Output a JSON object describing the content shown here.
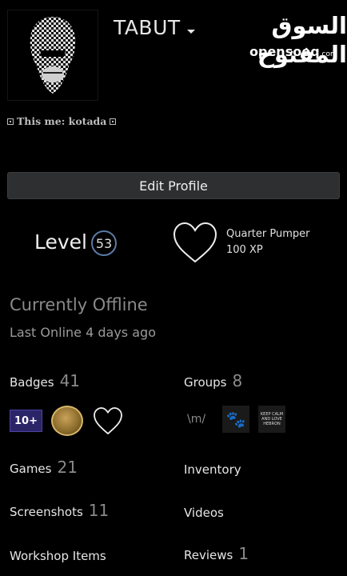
{
  "header": {
    "username": "TABUT",
    "watermark_ar": "السوق المفتوح",
    "watermark_en": "opensooq",
    "watermark_en_tld": ".com"
  },
  "profile": {
    "summary": "This me: kotada",
    "edit_button": "Edit Profile"
  },
  "level": {
    "label": "Level",
    "value": "53",
    "xp_title": "Quarter Pumper",
    "xp_value": "100 XP"
  },
  "status": {
    "state": "Currently Offline",
    "last_online": "Last Online 4 days ago"
  },
  "stats": {
    "badges_label": "Badges",
    "badges_count": "41",
    "groups_label": "Groups",
    "groups_count": "8",
    "games_label": "Games",
    "games_count": "21",
    "inventory_label": "Inventory",
    "screenshots_label": "Screenshots",
    "screenshots_count": "11",
    "videos_label": "Videos",
    "workshop_label": "Workshop Items",
    "reviews_label": "Reviews",
    "reviews_count": "1"
  },
  "badges": {
    "first_badge": "10+"
  },
  "groups": {
    "text_group": "\\m/",
    "calm_group": "KEEP CALM AND LOVE HEBRON"
  },
  "colors": {
    "background": "#000000",
    "button": "#2d2f31",
    "level_ring": "#5b7aa6",
    "badge_10_bg": "#2b2568"
  }
}
